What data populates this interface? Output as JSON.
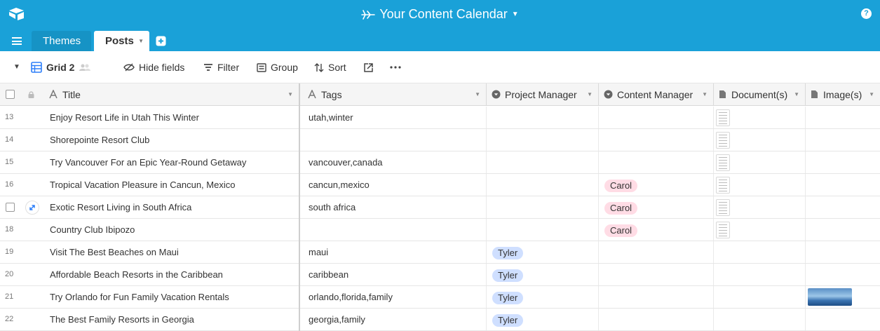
{
  "app": {
    "base_name": "Your Content Calendar",
    "help_label": "?"
  },
  "tabs": [
    {
      "label": "Themes",
      "active": false
    },
    {
      "label": "Posts",
      "active": true
    }
  ],
  "toolbar": {
    "view_name": "Grid 2",
    "hide_fields": "Hide fields",
    "filter": "Filter",
    "group": "Group",
    "sort": "Sort"
  },
  "columns": {
    "title": "Title",
    "tags": "Tags",
    "project_manager": "Project Manager",
    "content_manager": "Content Manager",
    "documents": "Document(s)",
    "images": "Image(s)"
  },
  "rows": [
    {
      "num": "13",
      "title": "Enjoy Resort Life in Utah This Winter",
      "tags": "utah,winter",
      "pm": "",
      "cm": "",
      "doc": true,
      "img": false
    },
    {
      "num": "14",
      "title": "Shorepointe Resort Club",
      "tags": "",
      "pm": "",
      "cm": "",
      "doc": true,
      "img": false
    },
    {
      "num": "15",
      "title": "Try Vancouver For an Epic Year-Round Getaway",
      "tags": "vancouver,canada",
      "pm": "",
      "cm": "",
      "doc": true,
      "img": false
    },
    {
      "num": "16",
      "title": "Tropical Vacation Pleasure in Cancun, Mexico",
      "tags": "cancun,mexico",
      "pm": "",
      "cm": "Carol",
      "doc": true,
      "img": false
    },
    {
      "num": "",
      "title": "Exotic Resort Living in South Africa",
      "tags": "south africa",
      "pm": "",
      "cm": "Carol",
      "doc": true,
      "img": false,
      "hovered": true
    },
    {
      "num": "18",
      "title": "Country Club Ibipozo",
      "tags": "",
      "pm": "",
      "cm": "Carol",
      "doc": true,
      "img": false
    },
    {
      "num": "19",
      "title": "Visit The Best Beaches on Maui",
      "tags": "maui",
      "pm": "Tyler",
      "cm": "",
      "doc": false,
      "img": false
    },
    {
      "num": "20",
      "title": "Affordable Beach Resorts in the Caribbean",
      "tags": "caribbean",
      "pm": "Tyler",
      "cm": "",
      "doc": false,
      "img": false
    },
    {
      "num": "21",
      "title": "Try Orlando for Fun Family Vacation Rentals",
      "tags": "orlando,florida,family",
      "pm": "Tyler",
      "cm": "",
      "doc": false,
      "img": true
    },
    {
      "num": "22",
      "title": "The Best Family Resorts in Georgia",
      "tags": "georgia,family",
      "pm": "Tyler",
      "cm": "",
      "doc": false,
      "img": false
    }
  ],
  "colors": {
    "header_blue": "#1aa1d8",
    "carol_pill": "#ffdce5",
    "tyler_pill": "#cfdfff"
  },
  "icons": [
    "airtable-logo-icon",
    "airplane-icon",
    "help-icon",
    "hamburger-menu-icon",
    "add-table-icon",
    "grid-view-icon",
    "hide-fields-icon",
    "filter-icon",
    "group-icon",
    "sort-icon",
    "share-icon",
    "more-icon",
    "expand-record-icon",
    "document-thumbnail-icon",
    "image-thumbnail"
  ]
}
